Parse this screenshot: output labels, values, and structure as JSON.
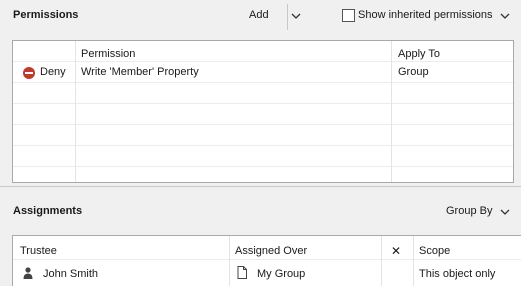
{
  "permissions": {
    "title": "Permissions",
    "add_label": "Add",
    "show_inherited_label": "Show inherited permissions",
    "show_inherited_checked": false,
    "columns": [
      "Permission",
      "Apply To"
    ],
    "rows": [
      {
        "type": "Deny",
        "permission": "Write 'Member' Property",
        "apply_to": "Group"
      }
    ]
  },
  "assignments": {
    "title": "Assignments",
    "group_by_label": "Group By",
    "columns": [
      "Trustee",
      "Assigned Over",
      "Scope"
    ],
    "close_glyph": "✕",
    "rows": [
      {
        "trustee": "John Smith",
        "assigned_over": "My Group",
        "scope": "This object only"
      }
    ]
  },
  "colors": {
    "deny": "#c0392b",
    "border": "#a9a9a9",
    "background": "#f0f0f0"
  }
}
